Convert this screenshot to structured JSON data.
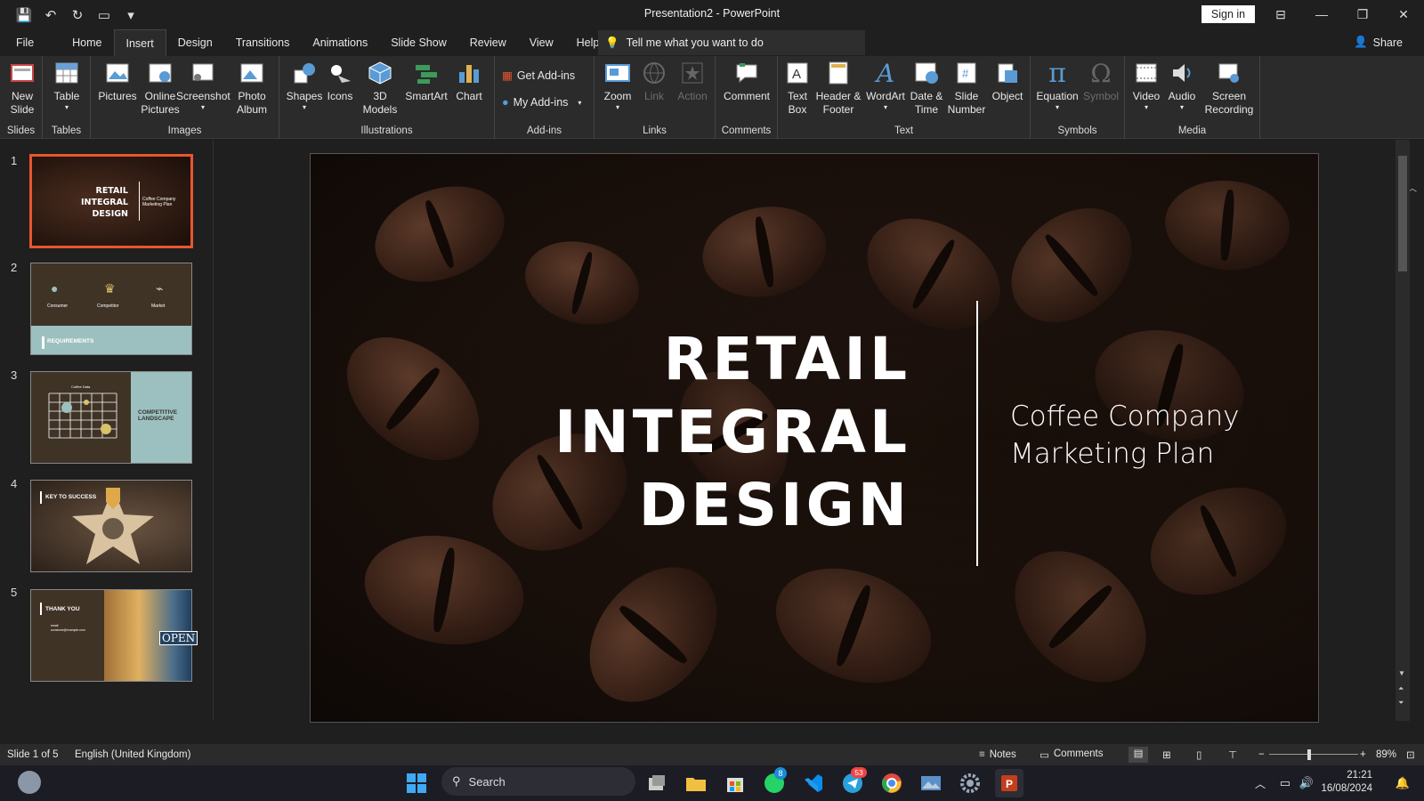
{
  "app": {
    "title": "Presentation2  -  PowerPoint",
    "signin": "Sign in",
    "share": "Share"
  },
  "menu": [
    "File",
    "Home",
    "Insert",
    "Design",
    "Transitions",
    "Animations",
    "Slide Show",
    "Review",
    "View",
    "Help"
  ],
  "tell": "Tell me what you want to do",
  "ribbon": {
    "groups": {
      "slides": "Slides",
      "tables": "Tables",
      "images": "Images",
      "illustrations": "Illustrations",
      "addins": "Add-ins",
      "links": "Links",
      "comments": "Comments",
      "text": "Text",
      "symbols": "Symbols",
      "media": "Media"
    },
    "new_slide": "New Slide",
    "table": "Table",
    "pictures": "Pictures",
    "online_pictures": "Online Pictures",
    "screenshot": "Screenshot",
    "photo_album": "Photo Album",
    "shapes": "Shapes",
    "icons": "Icons",
    "models": "3D Models",
    "smartart": "SmartArt",
    "chart": "Chart",
    "get_addins": "Get Add-ins",
    "my_addins": "My Add-ins",
    "zoom": "Zoom",
    "link": "Link",
    "action": "Action",
    "comment": "Comment",
    "text_box": "Text Box",
    "header_footer": "Header & Footer",
    "wordart": "WordArt",
    "date_time": "Date & Time",
    "slide_number": "Slide Number",
    "object": "Object",
    "equation": "Equation",
    "symbol": "Symbol",
    "video": "Video",
    "audio": "Audio",
    "screen_recording": "Screen Recording"
  },
  "thumbs": {
    "numbers": [
      "1",
      "2",
      "3",
      "4",
      "5"
    ],
    "t1": {
      "title": "RETAIL INTEGRAL DESIGN",
      "sub": "Coffee Company Marketing Plan"
    },
    "t2": {
      "labels": [
        "Consumer",
        "Competitor",
        "Market"
      ],
      "band": "REQUIREMENTS"
    },
    "t3": {
      "chart": "Coffee Data",
      "label": "COMPETITIVE LANDSCAPE"
    },
    "t4": {
      "label": "KEY TO SUCCESS"
    },
    "t5": {
      "label": "THANK YOU",
      "email": "email\nsomeone@example.com",
      "sign": "OPEN"
    }
  },
  "slide": {
    "title_lines": [
      "RETAIL",
      "INTEGRAL",
      "DESIGN"
    ],
    "subtitle_lines": [
      "Coffee Company",
      "Marketing Plan"
    ]
  },
  "status": {
    "slide": "Slide 1 of 5",
    "lang": "English (United Kingdom)",
    "notes": "Notes",
    "comments": "Comments",
    "zoom": "89%"
  },
  "taskbar": {
    "search": "Search",
    "time": "21:21",
    "date": "16/08/2024",
    "whatsapp_badge": "8",
    "telegram_badge": "53"
  },
  "colors": {
    "accent": "#e8562f",
    "ribbon": "#2b2b2b",
    "bg": "#1f1f1f"
  }
}
